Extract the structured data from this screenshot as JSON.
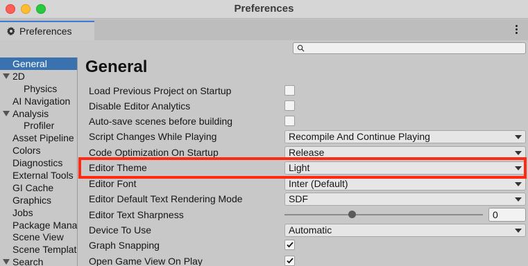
{
  "window": {
    "title": "Preferences"
  },
  "tab": {
    "label": "Preferences",
    "icon": "gear-icon"
  },
  "search": {
    "placeholder": "",
    "value": ""
  },
  "sidebar": {
    "items": [
      {
        "label": "General",
        "selected": true,
        "indent": 1,
        "arrow": false
      },
      {
        "label": "2D",
        "selected": false,
        "indent": 1,
        "arrow": true
      },
      {
        "label": "Physics",
        "selected": false,
        "indent": 2,
        "arrow": false
      },
      {
        "label": "AI Navigation",
        "selected": false,
        "indent": 1,
        "arrow": false
      },
      {
        "label": "Analysis",
        "selected": false,
        "indent": 1,
        "arrow": true
      },
      {
        "label": "Profiler",
        "selected": false,
        "indent": 2,
        "arrow": false
      },
      {
        "label": "Asset Pipeline",
        "selected": false,
        "indent": 1,
        "arrow": false
      },
      {
        "label": "Colors",
        "selected": false,
        "indent": 1,
        "arrow": false
      },
      {
        "label": "Diagnostics",
        "selected": false,
        "indent": 1,
        "arrow": false
      },
      {
        "label": "External Tools",
        "selected": false,
        "indent": 1,
        "arrow": false
      },
      {
        "label": "GI Cache",
        "selected": false,
        "indent": 1,
        "arrow": false
      },
      {
        "label": "Graphics",
        "selected": false,
        "indent": 1,
        "arrow": false
      },
      {
        "label": "Jobs",
        "selected": false,
        "indent": 1,
        "arrow": false
      },
      {
        "label": "Package Manager",
        "selected": false,
        "indent": 1,
        "arrow": false
      },
      {
        "label": "Scene View",
        "selected": false,
        "indent": 1,
        "arrow": false
      },
      {
        "label": "Scene Template",
        "selected": false,
        "indent": 1,
        "arrow": false
      },
      {
        "label": "Search",
        "selected": false,
        "indent": 1,
        "arrow": true
      }
    ]
  },
  "main": {
    "heading": "General",
    "settings": [
      {
        "label": "Load Previous Project on Startup",
        "control": "checkbox",
        "checked": false
      },
      {
        "label": "Disable Editor Analytics",
        "control": "checkbox",
        "checked": false
      },
      {
        "label": "Auto-save scenes before building",
        "control": "checkbox",
        "checked": false
      },
      {
        "label": "Script Changes While Playing",
        "control": "dropdown",
        "value": "Recompile And Continue Playing"
      },
      {
        "label": "Code Optimization On Startup",
        "control": "dropdown",
        "value": "Release"
      },
      {
        "label": "Editor Theme",
        "control": "dropdown",
        "value": "Light"
      },
      {
        "label": "Editor Font",
        "control": "dropdown",
        "value": "Inter (Default)"
      },
      {
        "label": "Editor Default Text Rendering Mode",
        "control": "dropdown",
        "value": "SDF"
      },
      {
        "label": "Editor Text Sharpness",
        "control": "slider",
        "value": "0"
      },
      {
        "label": "Device To Use",
        "control": "dropdown",
        "value": "Automatic"
      },
      {
        "label": "Graph Snapping",
        "control": "checkbox",
        "checked": true
      },
      {
        "label": "Open Game View On Play",
        "control": "checkbox",
        "checked": true
      }
    ]
  },
  "colors": {
    "selection": "#3a72b0",
    "highlight_box": "#ff2a12",
    "tab_accent": "#3b7bd6"
  }
}
